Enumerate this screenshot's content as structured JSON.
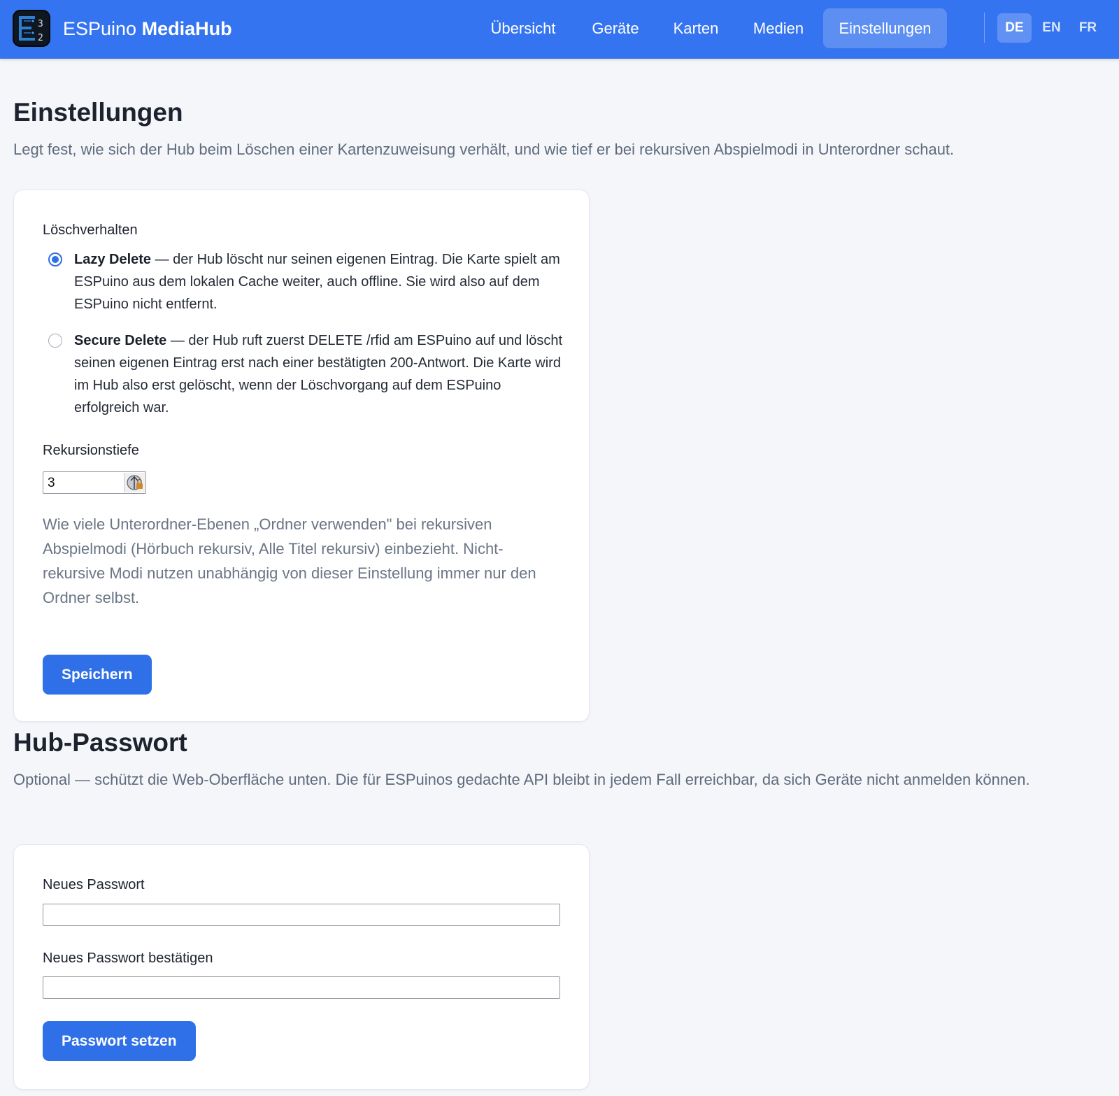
{
  "brand": {
    "name_part1": "ESPuino ",
    "name_part2": "MediaHub",
    "logo_icon": "espuino-logo-icon"
  },
  "nav": {
    "items": [
      {
        "label": "Übersicht",
        "active": false
      },
      {
        "label": "Geräte",
        "active": false
      },
      {
        "label": "Karten",
        "active": false
      },
      {
        "label": "Medien",
        "active": false
      },
      {
        "label": "Einstellungen",
        "active": true
      }
    ],
    "languages": [
      {
        "code": "DE",
        "active": true
      },
      {
        "code": "EN",
        "active": false
      },
      {
        "code": "FR",
        "active": false
      }
    ]
  },
  "settings": {
    "title": "Einstellungen",
    "description": "Legt fest, wie sich der Hub beim Löschen einer Kartenzuweisung verhält, und wie tief er bei rekursiven Abspielmodi in Unterordner schaut.",
    "delete_behavior": {
      "label": "Löschverhalten",
      "options": [
        {
          "name": "Lazy Delete",
          "description": " — der Hub löscht nur seinen eigenen Eintrag. Die Karte spielt am ESPuino aus dem lokalen Cache weiter, auch offline. Sie wird also auf dem ESPuino nicht entfernt.",
          "selected": true
        },
        {
          "name": "Secure Delete",
          "description": " — der Hub ruft zuerst DELETE /rfid am ESPuino auf und löscht seinen eigenen Eintrag erst nach einer bestätigten 200-Antwort. Die Karte wird im Hub also erst gelöscht, wenn der Löschvorgang auf dem ESPuino erfolgreich war.",
          "selected": false
        }
      ]
    },
    "recursion": {
      "label": "Rekursionstiefe",
      "value": "3",
      "help": "Wie viele Unterordner-Ebenen „Ordner verwenden\" bei rekursiven Abspielmodi (Hörbuch rekursiv, Alle Titel rekursiv) einbezieht. Nicht-rekursive Modi nutzen unabhängig von dieser Einstellung immer nur den Ordner selbst."
    },
    "save_label": "Speichern"
  },
  "password": {
    "title": "Hub-Passwort",
    "description": "Optional — schützt die Web-Oberfläche unten. Die für ESPuinos gedachte API bleibt in jedem Fall erreichbar, da sich Geräte nicht anmelden können.",
    "new_label": "Neues Passwort",
    "new_value": "",
    "confirm_label": "Neues Passwort bestätigen",
    "confirm_value": "",
    "submit_label": "Passwort setzen"
  },
  "colors": {
    "nav_bg": "#3574f0",
    "accent": "#2f6fe8",
    "page_bg": "#f4f6fa"
  }
}
